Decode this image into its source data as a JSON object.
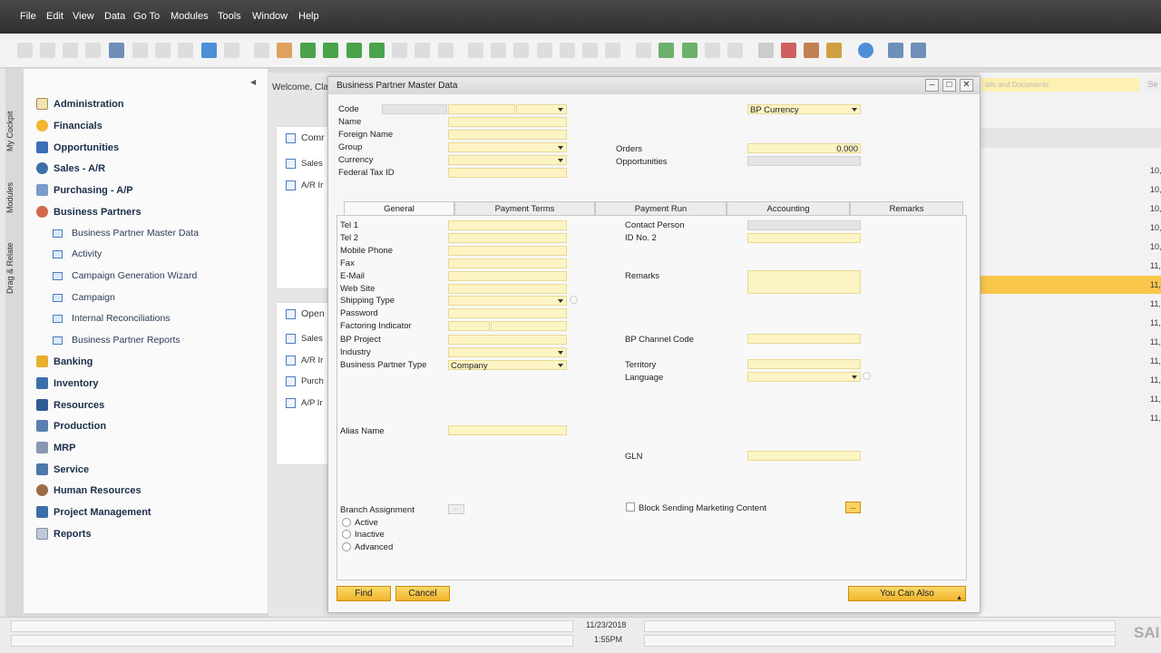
{
  "menu": [
    "File",
    "Edit",
    "View",
    "Data",
    "Go To",
    "Modules",
    "Tools",
    "Window",
    "Help"
  ],
  "vertical_tabs": [
    "My Cockpit",
    "Modules",
    "Drag & Relate"
  ],
  "nav": {
    "modules": [
      "Administration",
      "Financials",
      "Opportunities",
      "Sales - A/R",
      "Purchasing - A/P",
      "Business Partners"
    ],
    "sub_items": [
      "Business Partner Master Data",
      "Activity",
      "Campaign Generation Wizard",
      "Campaign",
      "Internal Reconciliations",
      "Business Partner Reports"
    ],
    "modules_after": [
      "Banking",
      "Inventory",
      "Resources",
      "Production",
      "MRP",
      "Service",
      "Human Resources",
      "Project Management",
      "Reports"
    ]
  },
  "cockpit": {
    "welcome": "Welcome, Cla",
    "widget1_title": "Comr",
    "widget1_rows": [
      "Sales",
      "A/R Ir"
    ],
    "widget2_title": "Open",
    "widget2_rows": [
      "Sales",
      "A/R Ir",
      "Purch",
      "A/P Ir"
    ],
    "search_placeholder": "ails and Documents",
    "dates": [
      "10,",
      "10,",
      "10,",
      "10,",
      "10,",
      "11,",
      "11,",
      "11,",
      "11,",
      "11,",
      "11,",
      "11,",
      "11,",
      "11,"
    ]
  },
  "form": {
    "title": "Business Partner Master Data",
    "header_labels": {
      "code": "Code",
      "name": "Name",
      "foreign_name": "Foreign Name",
      "group": "Group",
      "currency": "Currency",
      "federal_tax": "Federal Tax ID"
    },
    "bp_currency": "BP Currency",
    "orders_label": "Orders",
    "orders_value": "0.000",
    "opportunities_label": "Opportunities",
    "tabs": [
      "General",
      "Payment Terms",
      "Payment Run",
      "Accounting",
      "Remarks"
    ],
    "general_left": [
      "Tel 1",
      "Tel 2",
      "Mobile Phone",
      "Fax",
      "E-Mail",
      "Web Site",
      "Shipping Type",
      "Password",
      "Factoring Indicator",
      "BP Project",
      "Industry",
      "Business Partner Type"
    ],
    "bp_type_value": "Company",
    "alias_label": "Alias Name",
    "general_right": {
      "contact": "Contact Person",
      "id2": "ID No. 2",
      "remarks": "Remarks",
      "channel": "BP Channel Code",
      "territory": "Territory",
      "language": "Language",
      "gln": "GLN"
    },
    "branch_label": "Branch Assignment",
    "branch_options": [
      "Active",
      "Inactive",
      "Advanced"
    ],
    "block_marketing": "Block Sending Marketing Content",
    "find_button": "Find",
    "cancel_button": "Cancel",
    "also_button": "You Can Also"
  },
  "status": {
    "date": "11/23/2018",
    "time": "1:55PM",
    "logo": "SAI"
  }
}
